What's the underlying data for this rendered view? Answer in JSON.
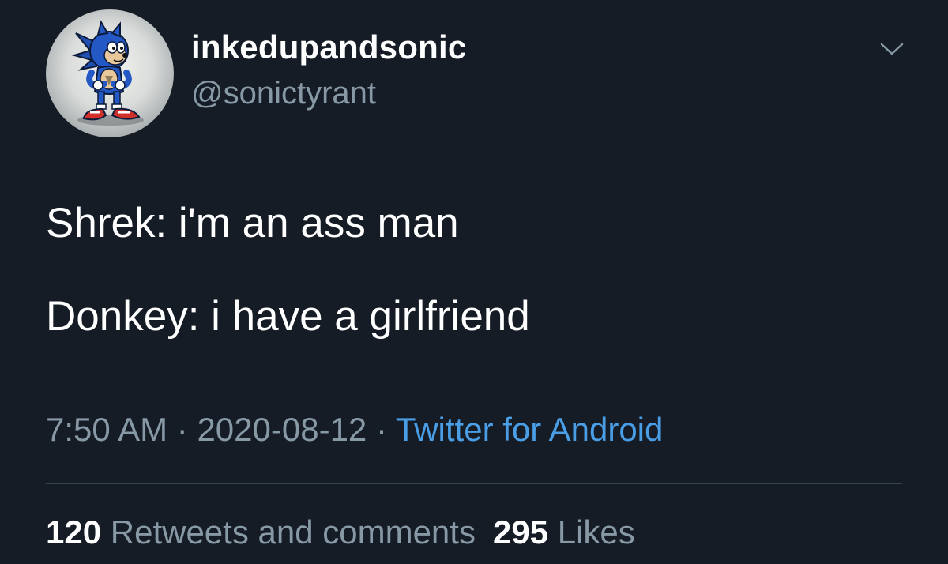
{
  "tweet": {
    "author": {
      "display_name": "inkedupandsonic",
      "handle": "@sonictyrant",
      "avatar_icon": "sonic-avatar-icon"
    },
    "menu_icon": "chevron-down-icon",
    "text_lines": [
      "Shrek: i'm an ass man",
      "Donkey: i have a girlfriend"
    ],
    "meta": {
      "time": "7:50 AM",
      "separator": "·",
      "date": "2020-08-12",
      "source": "Twitter for Android"
    },
    "stats": {
      "retweets_count": "120",
      "retweets_label": "Retweets and comments",
      "likes_count": "295",
      "likes_label": "Likes"
    }
  },
  "colors": {
    "background": "#151c26",
    "primary_text": "#ffffff",
    "secondary_text": "#8899a6",
    "link": "#4a9ee6",
    "divider": "#38444d"
  }
}
